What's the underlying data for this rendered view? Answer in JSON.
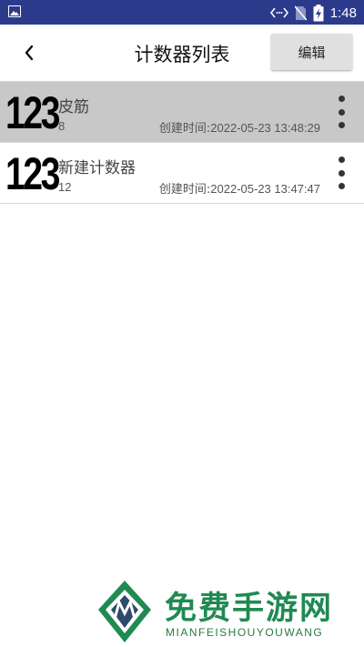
{
  "status_bar": {
    "time": "1:48",
    "icons": [
      "image-icon",
      "code-icon",
      "no-sim-icon",
      "battery-charging-icon"
    ]
  },
  "title_bar": {
    "title": "计数器列表",
    "edit_label": "编辑"
  },
  "counters": [
    {
      "icon_text": "123",
      "name": "皮筋",
      "count": "8",
      "time_label": "创建时间:",
      "time_value": "2022-05-23 13:48:29",
      "selected": true
    },
    {
      "icon_text": "123",
      "name": "新建计数器",
      "count": "12",
      "time_label": "创建时间:",
      "time_value": "2022-05-23 13:47:47",
      "selected": false
    }
  ],
  "watermark": {
    "brand": "免费手游网",
    "subtitle": "MIANFEISHOUYOUWANG"
  },
  "colors": {
    "status_bar": "#2c3a8c",
    "selected_row": "#c8c8c8",
    "edit_button": "#e0e0e0",
    "watermark_green": "#1f8a52"
  }
}
